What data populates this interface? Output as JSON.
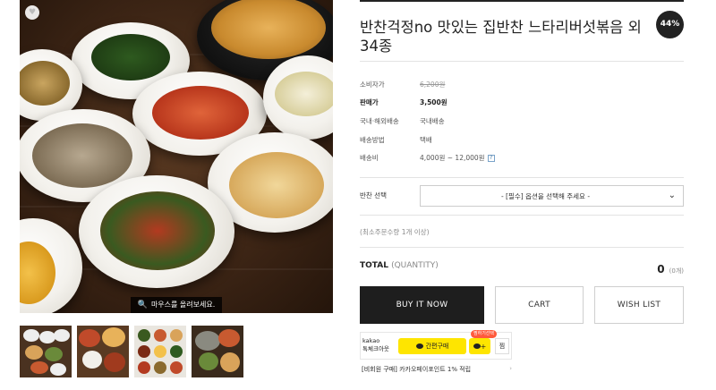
{
  "gallery": {
    "zoom_hint": "마우스를 올려보세요.",
    "zoom_icon": "magnifier-icon",
    "heart_icon": "heart-icon",
    "thumbnail_count": 4
  },
  "product": {
    "title": "반찬걱정no 맛있는 집반찬 느타리버섯볶음 외 34종",
    "discount_badge": "44%"
  },
  "specs": [
    {
      "label": "소비자가",
      "value": "6,200원"
    },
    {
      "label": "판매가",
      "value": "3,500원"
    },
    {
      "label": "국내·해외배송",
      "value": "국내배송"
    },
    {
      "label": "배송방법",
      "value": "택배"
    },
    {
      "label": "배송비",
      "value": "4,000원 ~ 12,000원"
    }
  ],
  "shipping_help_icon": "?",
  "option": {
    "label": "반찬 선택",
    "selected": "- [필수] 옵션을 선택해 주세요 -"
  },
  "min_order_note": "(최소주문수량 1개 이상)",
  "total": {
    "label": "TOTAL",
    "qty_label": "(QUANTITY)",
    "value": "0",
    "count": "(0개)"
  },
  "buttons": {
    "buy": "BUY IT NOW",
    "cart": "CART",
    "wish": "WISH LIST"
  },
  "kakao": {
    "brand_line1": "kakao",
    "brand_line2": "톡체크아웃",
    "pay_label": "간편구매",
    "wish_tag": "찜하기선택",
    "chat_label": "+",
    "share_label": "찜"
  },
  "member_promo": {
    "prefix": "[비회원 구매]",
    "text": " 카카오페이포인트 1% 적립"
  },
  "colors": {
    "buy_button": "#1e1e1e",
    "kakao_yellow": "#fee500",
    "discount_badge": "#222222"
  }
}
